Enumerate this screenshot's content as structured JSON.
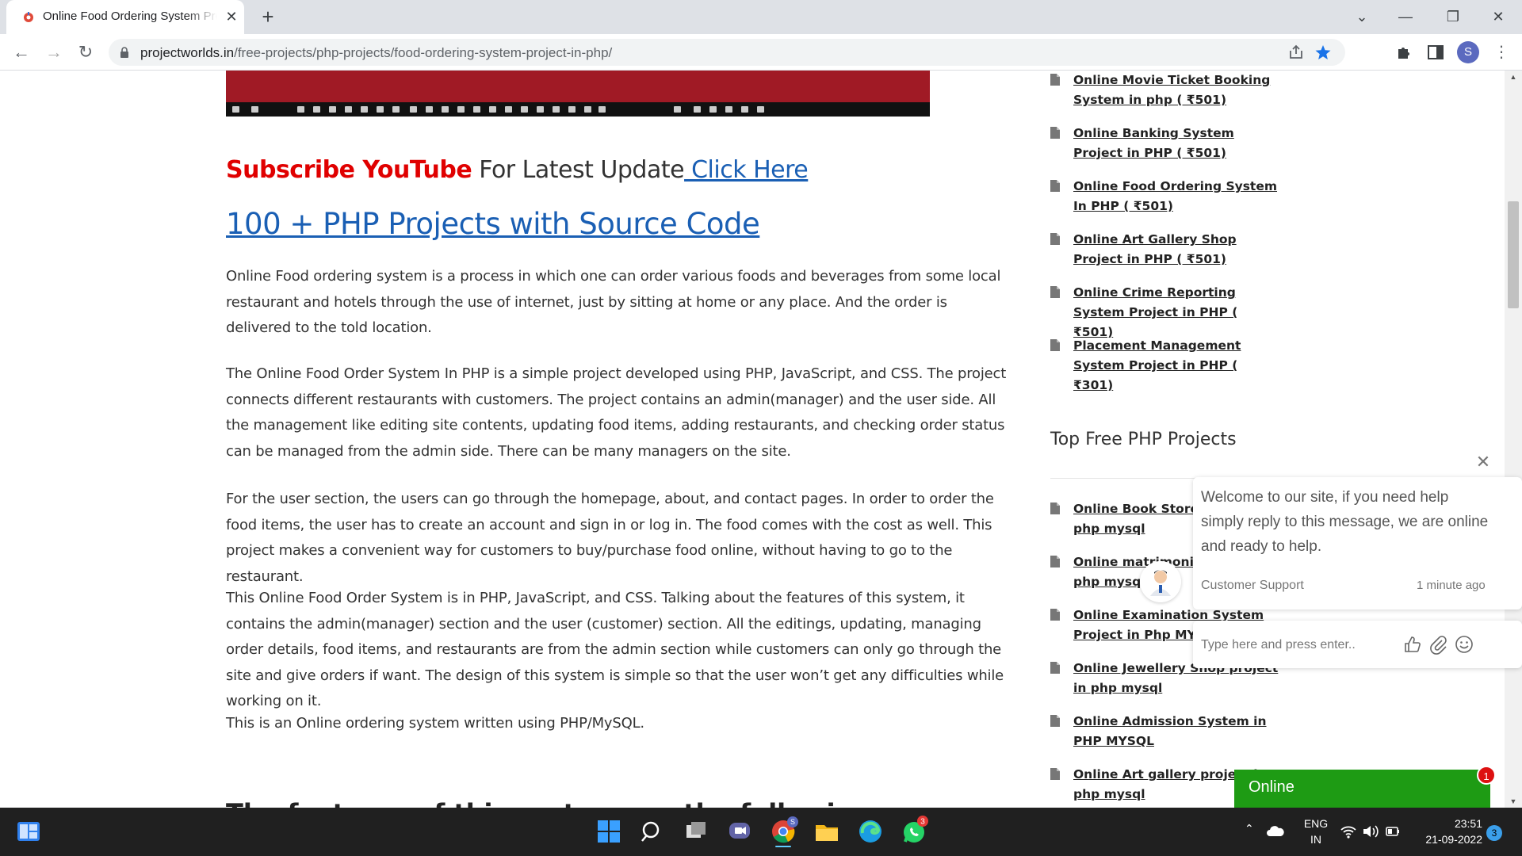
{
  "browser": {
    "tab_title": "Online Food Ordering System Project in PHP",
    "url_host": "projectworlds.in",
    "url_path": "/free-projects/php-projects/food-ordering-system-project-in-php/"
  },
  "article": {
    "subscribe_red": "Subscribe YouTube",
    "subscribe_text": " For Latest Update",
    "click_here": " Click Here",
    "php_projects_link": "100 + PHP Projects with Source Code",
    "paragraphs": [
      "Online Food ordering system is a process in which one can order various foods and beverages from some local restaurant and hotels through the use of internet, just by sitting at home or any place. And the order is delivered to the told location.",
      "The Online Food Order System In PHP is a simple project developed using PHP, JavaScript, and CSS. The project connects different restaurants with customers. The project contains an admin(manager) and the user side. All the management like editing site contents, updating food items, adding restaurants, and checking order status can be managed from the admin side. There can be many managers on the site.",
      "For the user section, the users can go through the homepage, about, and contact pages. In order to order the food items, the user has to create an account and sign in or log in. The food comes with the cost as well. This project makes a convenient way for customers to buy/purchase food online, without having to go to the restaurant.",
      "This Online Food Order System is in PHP, JavaScript, and CSS. Talking about the features of this system, it contains the admin(manager) section and the user (customer) section. All the editings, updating, managing order details, food items, and restaurants are from the admin section while customers can only go through the site and give orders if want. The design of this system is simple so that the user won’t get any difficulties while working on it.",
      "This is an Online ordering system written using PHP/MySQL."
    ],
    "next_heading": "The features of this system are the following:"
  },
  "sidebar": {
    "paid_projects": [
      "Online Movie Ticket Booking System in php ( ₹501)",
      "Online Banking System Project in PHP ( ₹501)",
      "Online Food Ordering System In PHP ( ₹501)",
      "Online Art Gallery Shop Project in PHP ( ₹501)",
      "Online Crime Reporting System Project in PHP ( ₹501)",
      "Placement Management System Project in PHP ( ₹301)"
    ],
    "top_free_heading": "Top Free PHP Projects",
    "free_projects": [
      "Online Book Store project in php mysql",
      "Online matrimonial project in php mysql",
      "Online Examination System Project in Php MYSQL",
      "Online Jewellery Shop project in php mysql",
      "Online Admission System in PHP MYSQL",
      "Online Art gallery project in php mysql"
    ]
  },
  "chat": {
    "message": "Welcome to our site, if you need help simply reply to this message, we are online and ready to help.",
    "agent": "Customer Support",
    "time": "1 minute ago",
    "input_placeholder": "Type here and press enter..",
    "status": "Online",
    "badge_count": "1"
  },
  "taskbar": {
    "lang_line1": "ENG",
    "lang_line2": "IN",
    "time": "23:51",
    "date": "21-09-2022",
    "whatsapp_badge": "3",
    "notification_count": "3",
    "chrome_profile": "S"
  },
  "profile_initial": "S",
  "colors": {
    "link_blue": "#1a5fb4",
    "subscribe_red": "#e00000",
    "chat_online_green": "#1e9b14",
    "taskbar_bg": "#202020"
  }
}
